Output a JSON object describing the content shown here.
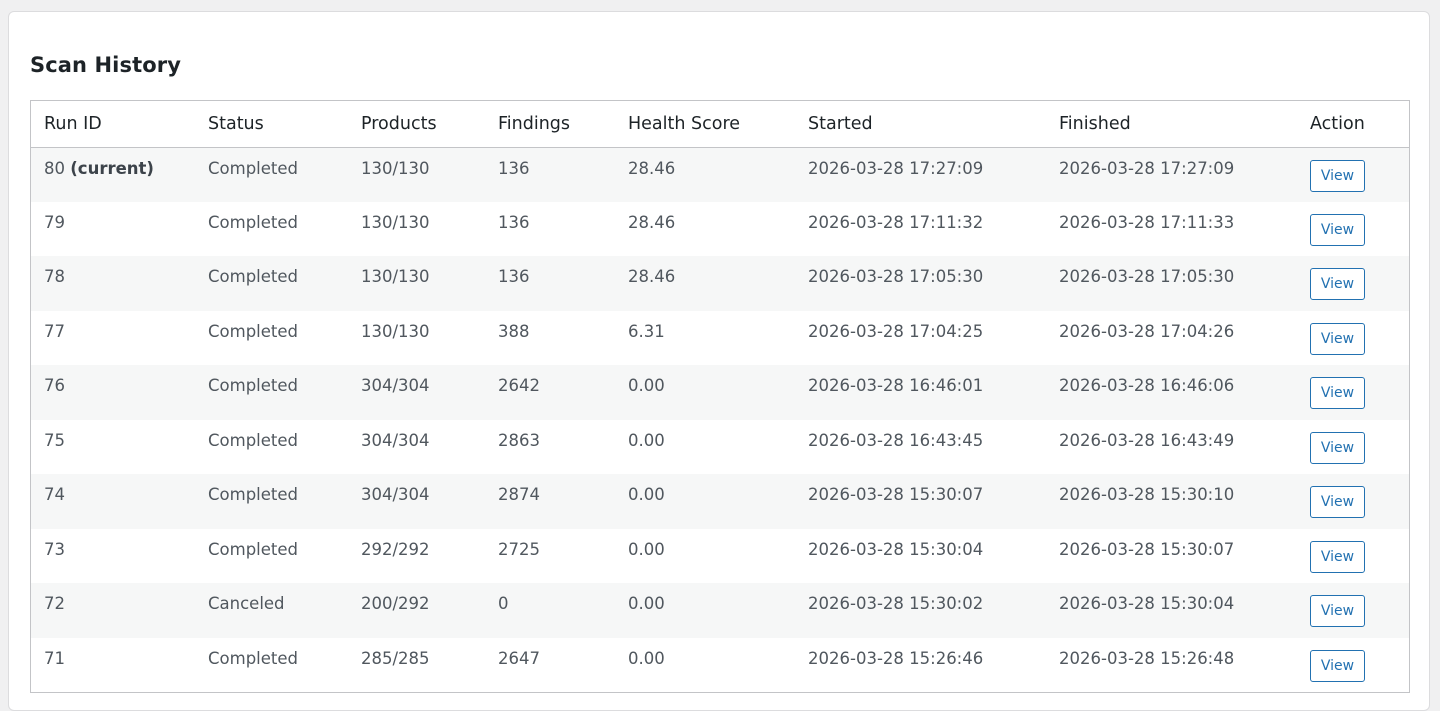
{
  "panel": {
    "title": "Scan History"
  },
  "table": {
    "headers": [
      "Run ID",
      "Status",
      "Products",
      "Findings",
      "Health Score",
      "Started",
      "Finished",
      "Action"
    ],
    "rows": [
      {
        "run_id": "80",
        "current_label": "(current)",
        "status": "Completed",
        "products": "130/130",
        "findings": "136",
        "health_score": "28.46",
        "started": "2026-03-28 17:27:09",
        "finished": "2026-03-28 17:27:09",
        "action": "View"
      },
      {
        "run_id": "79",
        "current_label": "",
        "status": "Completed",
        "products": "130/130",
        "findings": "136",
        "health_score": "28.46",
        "started": "2026-03-28 17:11:32",
        "finished": "2026-03-28 17:11:33",
        "action": "View"
      },
      {
        "run_id": "78",
        "current_label": "",
        "status": "Completed",
        "products": "130/130",
        "findings": "136",
        "health_score": "28.46",
        "started": "2026-03-28 17:05:30",
        "finished": "2026-03-28 17:05:30",
        "action": "View"
      },
      {
        "run_id": "77",
        "current_label": "",
        "status": "Completed",
        "products": "130/130",
        "findings": "388",
        "health_score": "6.31",
        "started": "2026-03-28 17:04:25",
        "finished": "2026-03-28 17:04:26",
        "action": "View"
      },
      {
        "run_id": "76",
        "current_label": "",
        "status": "Completed",
        "products": "304/304",
        "findings": "2642",
        "health_score": "0.00",
        "started": "2026-03-28 16:46:01",
        "finished": "2026-03-28 16:46:06",
        "action": "View"
      },
      {
        "run_id": "75",
        "current_label": "",
        "status": "Completed",
        "products": "304/304",
        "findings": "2863",
        "health_score": "0.00",
        "started": "2026-03-28 16:43:45",
        "finished": "2026-03-28 16:43:49",
        "action": "View"
      },
      {
        "run_id": "74",
        "current_label": "",
        "status": "Completed",
        "products": "304/304",
        "findings": "2874",
        "health_score": "0.00",
        "started": "2026-03-28 15:30:07",
        "finished": "2026-03-28 15:30:10",
        "action": "View"
      },
      {
        "run_id": "73",
        "current_label": "",
        "status": "Completed",
        "products": "292/292",
        "findings": "2725",
        "health_score": "0.00",
        "started": "2026-03-28 15:30:04",
        "finished": "2026-03-28 15:30:07",
        "action": "View"
      },
      {
        "run_id": "72",
        "current_label": "",
        "status": "Canceled",
        "products": "200/292",
        "findings": "0",
        "health_score": "0.00",
        "started": "2026-03-28 15:30:02",
        "finished": "2026-03-28 15:30:04",
        "action": "View"
      },
      {
        "run_id": "71",
        "current_label": "",
        "status": "Completed",
        "products": "285/285",
        "findings": "2647",
        "health_score": "0.00",
        "started": "2026-03-28 15:26:46",
        "finished": "2026-03-28 15:26:48",
        "action": "View"
      }
    ]
  },
  "colors": {
    "accent": "#2271b1",
    "page_background": "#f0f0f1",
    "striped_row": "#f6f7f7",
    "border": "#c3c4c7"
  }
}
